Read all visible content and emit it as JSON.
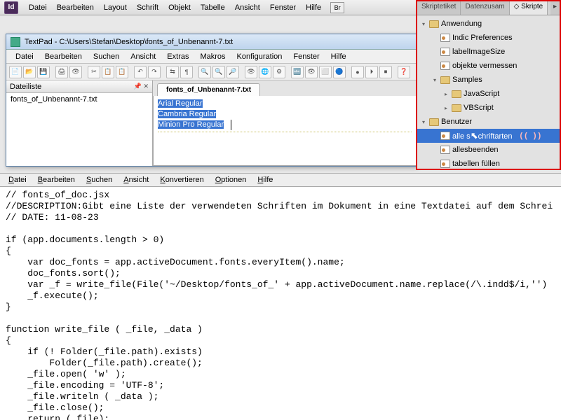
{
  "indesign": {
    "logo": "Id",
    "menu": [
      "Datei",
      "Bearbeiten",
      "Layout",
      "Schrift",
      "Objekt",
      "Tabelle",
      "Ansicht",
      "Fenster",
      "Hilfe"
    ],
    "bridge": "Br"
  },
  "scripts_panel": {
    "tabs": [
      "Skriptetiket",
      "Datenzusam",
      "Skripte"
    ],
    "active_tab": 2,
    "tree": [
      {
        "depth": 0,
        "tw": "▾",
        "ico": "folder",
        "label": "Anwendung"
      },
      {
        "depth": 1,
        "tw": "",
        "ico": "script",
        "label": "Indic Preferences"
      },
      {
        "depth": 1,
        "tw": "",
        "ico": "script",
        "label": "labelImageSize"
      },
      {
        "depth": 1,
        "tw": "",
        "ico": "script",
        "label": "objekte vermessen"
      },
      {
        "depth": 1,
        "tw": "▾",
        "ico": "folder",
        "label": "Samples"
      },
      {
        "depth": 2,
        "tw": "▸",
        "ico": "folder",
        "label": "JavaScript"
      },
      {
        "depth": 2,
        "tw": "▸",
        "ico": "folder",
        "label": "VBScript"
      },
      {
        "depth": 0,
        "tw": "▾",
        "ico": "folder",
        "label": "Benutzer"
      },
      {
        "depth": 1,
        "tw": "",
        "ico": "script",
        "label": "alle schriftarten",
        "sel": true,
        "cursor": true,
        "paren": "((  ))"
      },
      {
        "depth": 1,
        "tw": "",
        "ico": "script",
        "label": "allesbeenden"
      },
      {
        "depth": 1,
        "tw": "",
        "ico": "script",
        "label": "tabellen füllen"
      }
    ]
  },
  "textpad": {
    "title": "TextPad - C:\\Users\\Stefan\\Desktop\\fonts_of_Unbenannt-7.txt",
    "menu": [
      "Datei",
      "Bearbeiten",
      "Suchen",
      "Ansicht",
      "Extras",
      "Makros",
      "Konfiguration",
      "Fenster",
      "Hilfe"
    ],
    "filelist_title": "Dateiliste",
    "filelist_item": "fonts_of_Unbenannt-7.txt",
    "tab": "fonts_of_Unbenannt-7.txt",
    "content": [
      "Arial   Regular",
      "Cambria Regular",
      "Minion Pro      Regular"
    ]
  },
  "estk": {
    "menu": [
      "Datei",
      "Bearbeiten",
      "Suchen",
      "Ansicht",
      "Konvertieren",
      "Optionen",
      "Hilfe"
    ]
  },
  "code": "// fonts_of_doc.jsx\n//DESCRIPTION:Gibt eine Liste der verwendeten Schriften im Dokument in eine Textdatei auf dem Schrei\n// DATE: 11-08-23\n\nif (app.documents.length > 0)\n{\n    var doc_fonts = app.activeDocument.fonts.everyItem().name;\n    doc_fonts.sort();\n    var _f = write_file(File('~/Desktop/fonts_of_' + app.activeDocument.name.replace(/\\.indd$/i,'')\n    _f.execute();\n}\n\nfunction write_file ( _file, _data )\n{\n    if (! Folder(_file.path).exists)\n        Folder(_file.path).create();\n    _file.open( 'w' );\n    _file.encoding = 'UTF-8';\n    _file.writeln ( _data );\n    _file.close();\n    return (_file);\n}"
}
